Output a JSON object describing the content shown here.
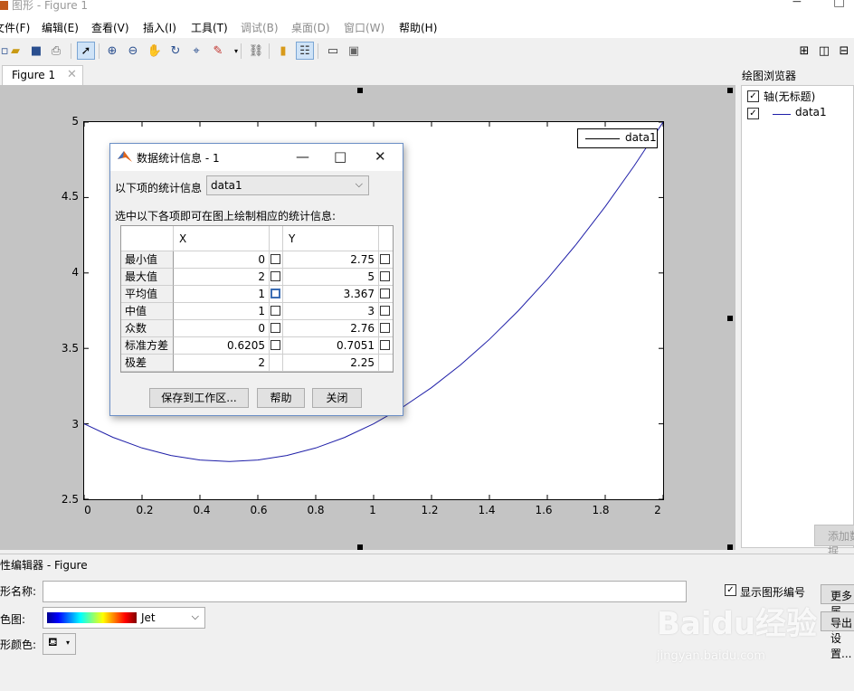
{
  "window": {
    "title": "图形 - Figure 1"
  },
  "menu": {
    "items": [
      "文件(F)",
      "编辑(E)",
      "查看(V)",
      "插入(I)",
      "工具(T)",
      "调试(B)",
      "桌面(D)",
      "窗口(W)",
      "帮助(H)"
    ],
    "disabled": [
      "调试(B)",
      "桌面(D)",
      "窗口(W)"
    ]
  },
  "toolbar": {
    "icons": [
      "new-figure-icon",
      "open-icon",
      "save-icon",
      "print-icon",
      "edit-plot-arrow-icon",
      "zoom-in-icon",
      "zoom-out-icon",
      "pan-hand-icon",
      "rotate-3d-icon",
      "data-cursor-icon",
      "brush-icon",
      "link-plot-icon",
      "colorbar-icon",
      "legend-icon",
      "hide-plot-tools-icon",
      "show-plot-tools-icon"
    ],
    "layout_icons": [
      "tile-grid-icon",
      "tile-columns-icon",
      "tile-rows-icon"
    ]
  },
  "tabs": [
    {
      "label": "Figure 1"
    }
  ],
  "plot": {
    "line_color": "#1f1fa8",
    "legend": [
      "data1"
    ]
  },
  "chart_data": {
    "type": "line",
    "title": "",
    "xlabel": "",
    "ylabel": "",
    "xlim": [
      0,
      2
    ],
    "ylim": [
      2.5,
      5
    ],
    "x_ticks": [
      "0",
      "0.2",
      "0.4",
      "0.6",
      "0.8",
      "1",
      "1.2",
      "1.4",
      "1.6",
      "1.8",
      "2"
    ],
    "y_ticks": [
      "5",
      "4.5",
      "4",
      "3.5",
      "3",
      "2.5"
    ],
    "series": [
      {
        "name": "data1",
        "x": [
          0,
          0.1,
          0.2,
          0.3,
          0.4,
          0.5,
          0.6,
          0.7,
          0.8,
          0.9,
          1.0,
          1.1,
          1.2,
          1.3,
          1.4,
          1.5,
          1.6,
          1.7,
          1.8,
          1.9,
          2.0
        ],
        "y": [
          3.0,
          2.91,
          2.84,
          2.79,
          2.76,
          2.75,
          2.76,
          2.79,
          2.84,
          2.91,
          3.0,
          3.11,
          3.24,
          3.39,
          3.56,
          3.75,
          3.96,
          4.19,
          4.44,
          4.71,
          5.0
        ]
      }
    ],
    "grid": false,
    "legend_position": "top-right"
  },
  "plot_browser": {
    "title": "绘图浏览器",
    "items": [
      {
        "label": "轴(无标题)",
        "checked": true
      },
      {
        "label": "data1",
        "checked": true
      }
    ],
    "add_button": "添加数据"
  },
  "stats_dialog": {
    "title": "数据统计信息 - 1",
    "source_label": "以下项的统计信息",
    "source_value": "data1",
    "hint": "选中以下各项即可在图上绘制相应的统计信息:",
    "columns": [
      "X",
      "Y"
    ],
    "rows": [
      {
        "label": "最小值",
        "x": "0",
        "y": "2.75"
      },
      {
        "label": "最大值",
        "x": "2",
        "y": "5"
      },
      {
        "label": "平均值",
        "x": "1",
        "y": "3.367"
      },
      {
        "label": "中值",
        "x": "1",
        "y": "3"
      },
      {
        "label": "众数",
        "x": "0",
        "y": "2.76"
      },
      {
        "label": "标准方差",
        "x": "0.6205",
        "y": "0.7051"
      },
      {
        "label": "极差",
        "x": "2",
        "y": "2.25"
      }
    ],
    "buttons": {
      "save": "保存到工作区...",
      "help": "帮助",
      "close": "关闭"
    }
  },
  "property_editor": {
    "title": "属性编辑器 - Figure",
    "name_label": "图形名称:",
    "name_value": "",
    "show_number_label": "显示图形编号",
    "show_number_checked": true,
    "colormap_label": "颜色图:",
    "colormap_value": "Jet",
    "figure_color_label": "图形颜色:",
    "more_button": "更多属性...",
    "export_button": "导出设置..."
  },
  "watermark": {
    "text": "Baidu经验",
    "subtext": "jingyan.baidu.com"
  }
}
